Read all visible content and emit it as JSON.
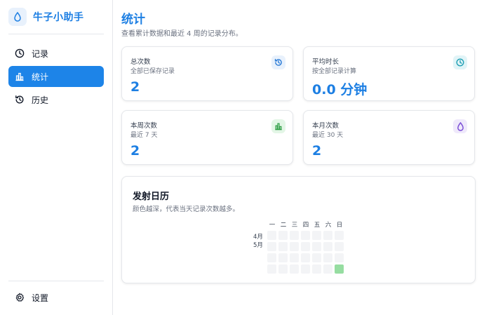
{
  "brand": {
    "title": "牛子小助手",
    "icon": "droplet-icon"
  },
  "sidebar": {
    "items": [
      {
        "label": "记录",
        "icon": "clock-icon",
        "active": false
      },
      {
        "label": "统计",
        "icon": "bar-chart-icon",
        "active": true
      },
      {
        "label": "历史",
        "icon": "history-icon",
        "active": false
      }
    ],
    "settings_label": "设置"
  },
  "page": {
    "title": "统计",
    "subtitle": "查看累计数据和最近 4 周的记录分布。"
  },
  "stats": [
    {
      "title": "总次数",
      "subtitle": "全部已保存记录",
      "value": "2",
      "icon": "history-icon",
      "badge_bg": "#e8f1fc",
      "badge_fg": "#2b7bd6"
    },
    {
      "title": "平均时长",
      "subtitle": "按全部记录计算",
      "value": "0.0 分钟",
      "icon": "clock-icon",
      "badge_bg": "#e1f4f7",
      "badge_fg": "#1f9fb4"
    },
    {
      "title": "本周次数",
      "subtitle": "最近 7 天",
      "value": "2",
      "icon": "bar-chart-icon",
      "badge_bg": "#e3f6e6",
      "badge_fg": "#2e9e45"
    },
    {
      "title": "本月次数",
      "subtitle": "最近 30 天",
      "value": "2",
      "icon": "droplet-icon",
      "badge_bg": "#efe9fb",
      "badge_fg": "#7c4fd6"
    }
  ],
  "calendar": {
    "title": "发射日历",
    "subtitle": "颜色越深，代表当天记录次数越多。",
    "weekdays": [
      "一",
      "二",
      "三",
      "四",
      "五",
      "六",
      "日"
    ],
    "months": [
      "4月",
      "5月"
    ],
    "rows": [
      [
        0,
        0,
        0,
        0,
        0,
        0,
        0
      ],
      [
        0,
        0,
        0,
        0,
        0,
        0,
        0
      ],
      [
        0,
        0,
        0,
        0,
        0,
        0,
        0
      ],
      [
        0,
        0,
        0,
        0,
        0,
        0,
        2
      ]
    ],
    "cell_color_empty": "#f3f4f6",
    "cell_color_hot": "#96dda1"
  }
}
